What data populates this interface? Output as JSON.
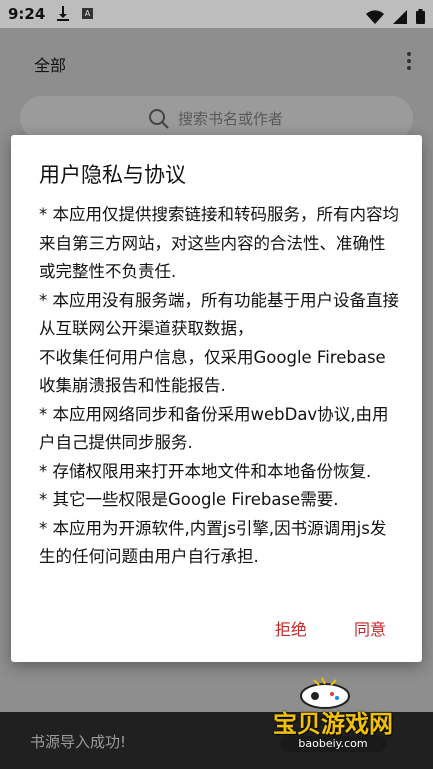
{
  "status_bar": {
    "time": "9:24",
    "download_icon": "download-icon",
    "a_badge": "A"
  },
  "app_bar": {
    "title": "全部",
    "menu_icon": "more-vert-icon"
  },
  "search": {
    "placeholder": "搜索书名或作者"
  },
  "dialog": {
    "title": "用户隐私与协议",
    "paragraphs": [
      "* 本应用仅提供搜索链接和转码服务，所有内容均来自第三方网站，对这些内容的合法性、准确性或完整性不负责任.",
      "* 本应用没有服务端，所有功能基于用户设备直接从互联网公开渠道获取数据，",
      "不收集任何用户信息，仅采用Google Firebase收集崩溃报告和性能报告.",
      "* 本应用网络同步和备份采用webDav协议,由用户自己提供同步服务.",
      "* 存储权限用来打开本地文件和本地备份恢复.",
      "* 其它一些权限是Google Firebase需要.",
      "* 本应用为开源软件,内置js引擎,因书源调用js发生的任何问题由用户自行承担."
    ],
    "reject_label": "拒绝",
    "accept_label": "同意",
    "accent_color": "#c62828"
  },
  "toast": {
    "message": "书源导入成功!"
  },
  "watermark": {
    "brand": "宝贝游戏网",
    "url": "baobeiy.com"
  }
}
